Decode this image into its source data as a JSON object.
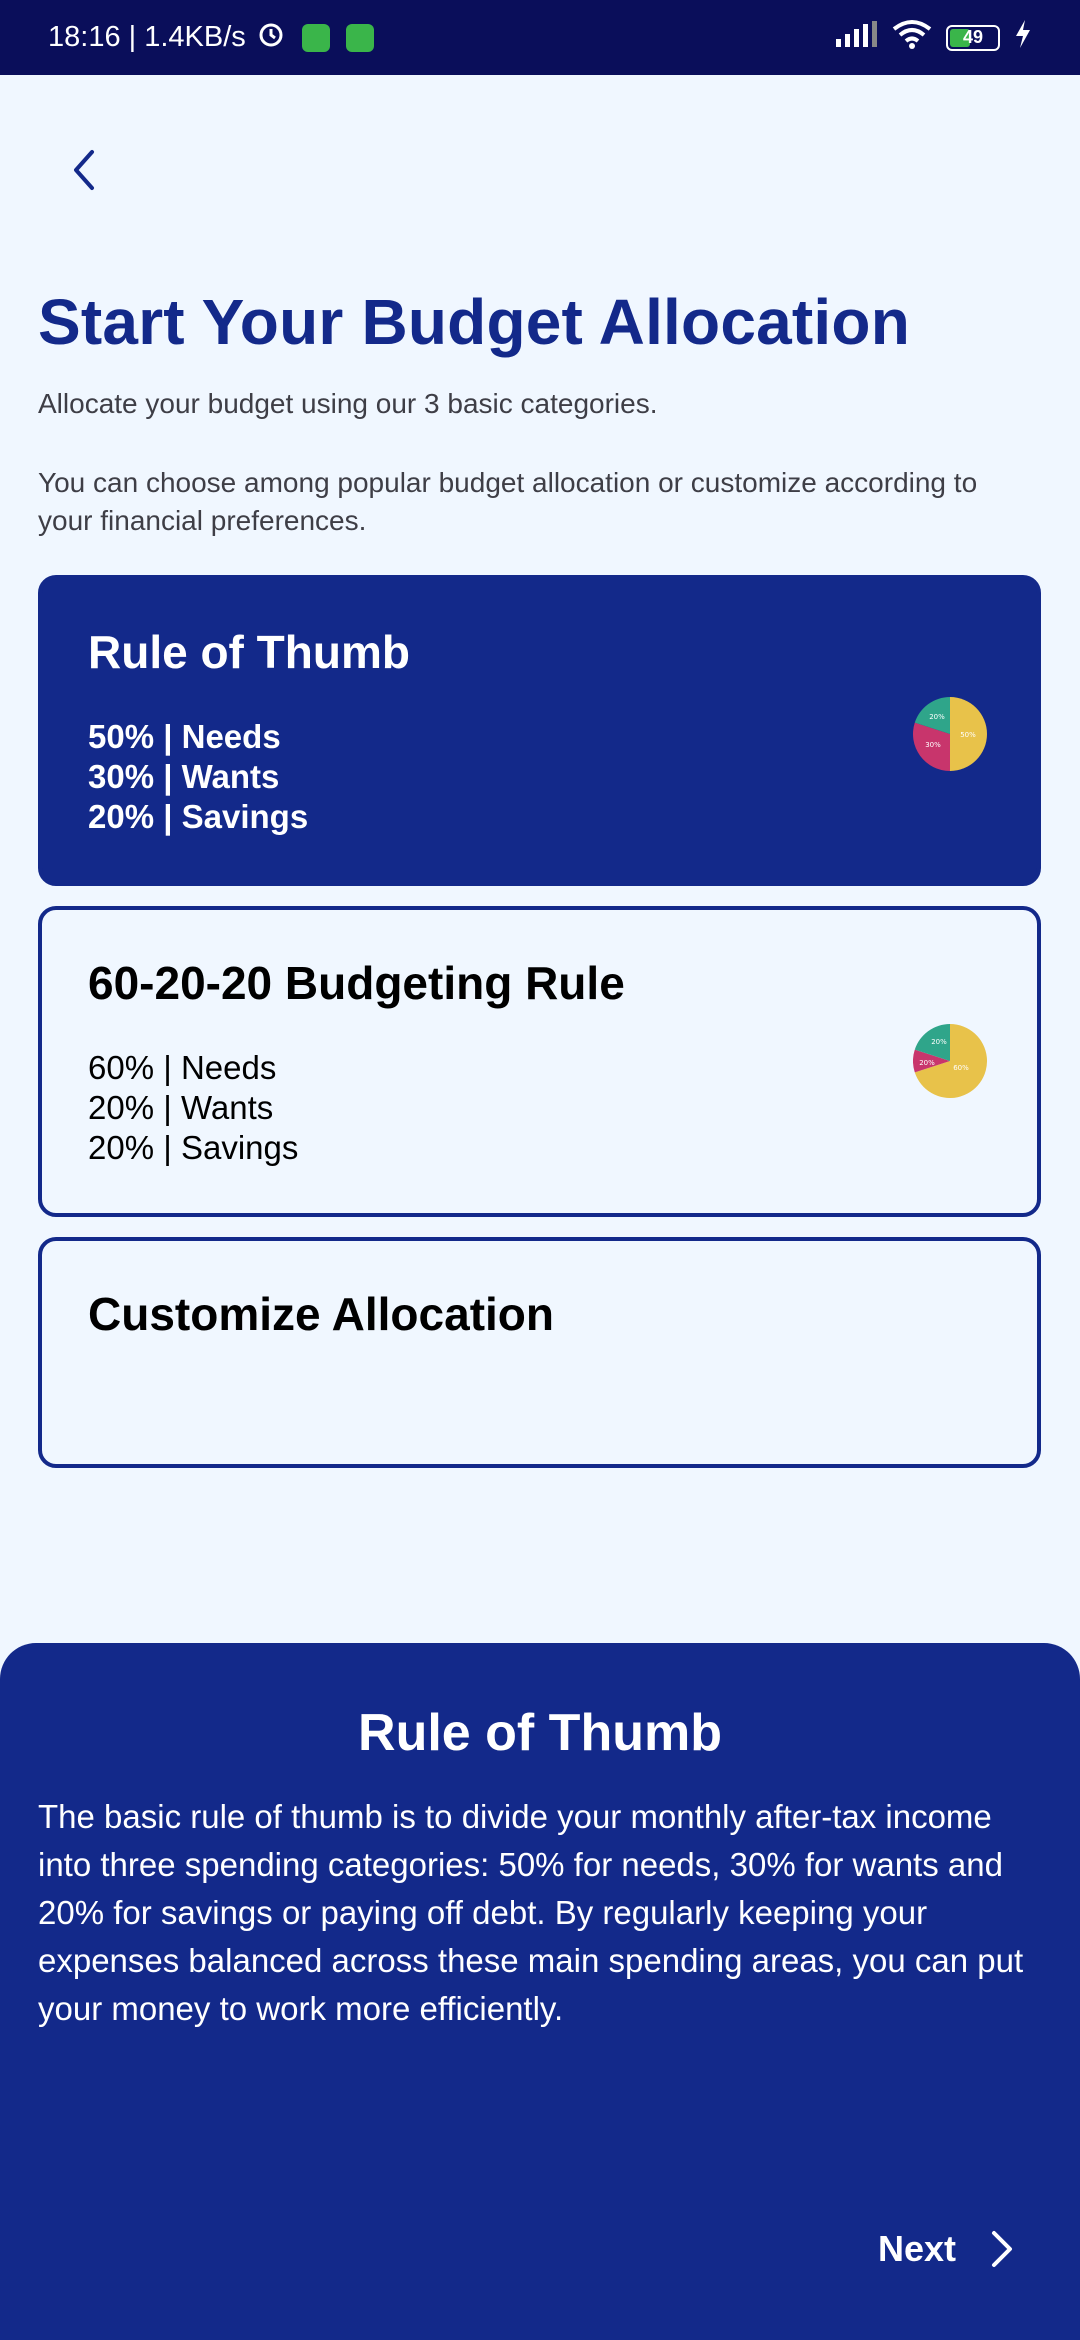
{
  "status_bar": {
    "time_speed": "18:16 | 1.4KB/s",
    "battery": "49"
  },
  "header": {
    "back_icon": "chevron-left-icon",
    "title": "Start Your Budget Allocation",
    "subtitle": "Allocate your budget using our 3 basic categories.",
    "description": "You can choose among popular budget allocation or customize according to your financial preferences."
  },
  "options": [
    {
      "title": "Rule of Thumb",
      "lines": [
        "50% | Needs",
        "30% | Wants",
        "20% | Savings"
      ],
      "selected": true,
      "pie_labels": [
        "30%",
        "50%",
        "20%"
      ]
    },
    {
      "title": "60-20-20 Budgeting Rule",
      "lines": [
        "60% | Needs",
        "20% | Wants",
        "20% | Savings"
      ],
      "selected": false,
      "pie_labels": [
        "20%",
        "60%",
        "20%"
      ]
    },
    {
      "title": "Customize Allocation",
      "lines": [],
      "selected": false
    }
  ],
  "colors": {
    "primary": "#13298a",
    "status_bar": "#0a0e5a",
    "background": "#f0f7ff",
    "pie_needs": "#e8c24a",
    "pie_wants": "#c8356c",
    "pie_savings": "#2fa58a"
  },
  "detail_sheet": {
    "title": "Rule of Thumb",
    "body": "The basic rule of thumb is to divide your monthly after-tax income into three spending categories: 50% for needs, 30% for wants and 20% for savings or paying off debt. By regularly keeping your expenses balanced across these main spending areas, you can put your money to work more efficiently.",
    "next_label": "Next",
    "next_icon": "chevron-right-icon"
  }
}
